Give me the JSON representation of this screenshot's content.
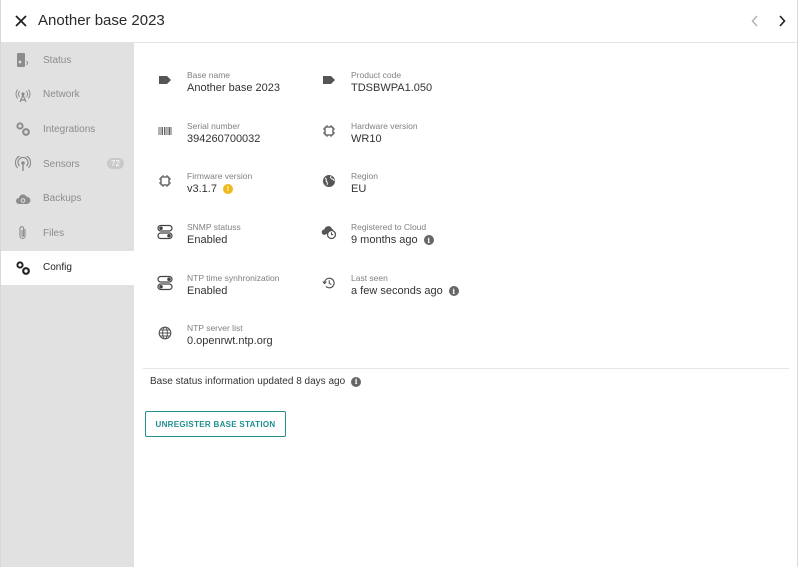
{
  "header": {
    "title": "Another base 2023",
    "close_icon": "close-icon",
    "prev_icon": "chevron-left-icon",
    "next_icon": "chevron-right-icon"
  },
  "sidebar": {
    "items": [
      {
        "label": "Status",
        "icon": "base-station-icon"
      },
      {
        "label": "Network",
        "icon": "antenna-icon"
      },
      {
        "label": "Integrations",
        "icon": "cogs-icon"
      },
      {
        "label": "Sensors",
        "icon": "sensor-icon",
        "badge": "72"
      },
      {
        "label": "Backups",
        "icon": "cloud-backup-icon"
      },
      {
        "label": "Files",
        "icon": "paperclip-icon"
      },
      {
        "label": "Config",
        "icon": "cogs-icon",
        "active": true
      }
    ]
  },
  "details": {
    "base_name": {
      "label": "Base name",
      "value": "Another base 2023"
    },
    "product_code": {
      "label": "Product code",
      "value": "TDSBWPA1.050"
    },
    "serial_number": {
      "label": "Serial number",
      "value": "394260700032"
    },
    "hardware_version": {
      "label": "Hardware version",
      "value": "WR10"
    },
    "firmware_version": {
      "label": "Firmware version",
      "value": "v3.1.7"
    },
    "region": {
      "label": "Region",
      "value": "EU"
    },
    "snmp_status": {
      "label": "SNMP statuss",
      "value": "Enabled"
    },
    "registered_to_cloud": {
      "label": "Registered to Cloud",
      "value": "9 months ago"
    },
    "ntp_sync": {
      "label": "NTP time synhronization",
      "value": "Enabled"
    },
    "last_seen": {
      "label": "Last seen",
      "value": "a few seconds ago"
    },
    "ntp_servers": {
      "label": "NTP server list",
      "value": "0.openrwt.ntp.org"
    }
  },
  "status_line": "Base status information updated 8 days ago",
  "unregister_label": "UNREGISTER BASE STATION",
  "colors": {
    "accent": "#1f8e8e",
    "warning": "#f1b81a",
    "sidebar_bg": "#e1e1e1"
  }
}
